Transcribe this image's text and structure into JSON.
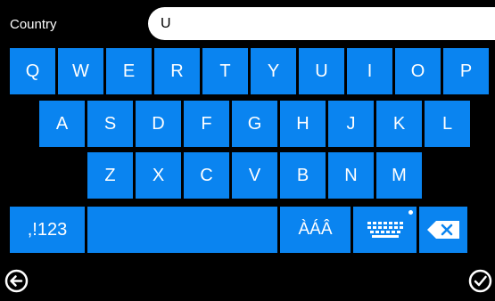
{
  "header": {
    "label": "Country",
    "value": "U"
  },
  "keyboard": {
    "row1": [
      "Q",
      "W",
      "E",
      "R",
      "T",
      "Y",
      "U",
      "I",
      "O",
      "P"
    ],
    "row2": [
      "A",
      "S",
      "D",
      "F",
      "G",
      "H",
      "J",
      "K",
      "L"
    ],
    "row3": [
      "Z",
      "X",
      "C",
      "V",
      "B",
      "N",
      "M"
    ],
    "bottom": {
      "symbols": ",!123",
      "accents": "ÀÁÂ"
    }
  },
  "icons": {
    "back": "back-arrow-icon",
    "confirm": "checkmark-icon",
    "keyboard": "keyboard-icon",
    "delete": "backspace-icon"
  },
  "colors": {
    "key": "#0a84f0",
    "background": "#000000",
    "field": "#ffffff"
  }
}
